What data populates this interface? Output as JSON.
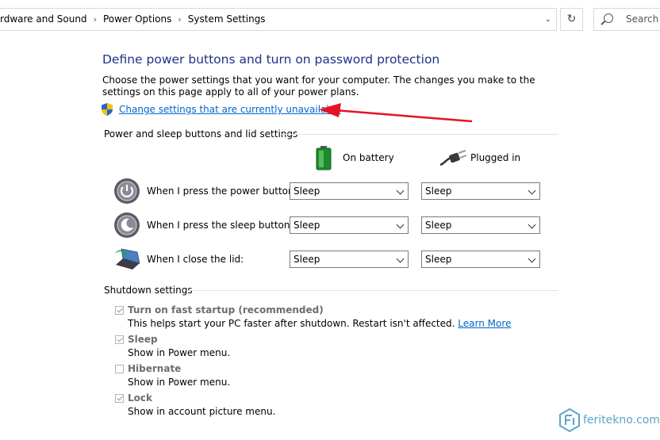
{
  "address": {
    "crumbs": [
      "rdware and Sound",
      "Power Options",
      "System Settings"
    ],
    "search_placeholder": "Search C"
  },
  "page": {
    "title": "Define power buttons and turn on password protection",
    "description": "Choose the power settings that you want for your computer. The changes you make to the settings on this page apply to all of your power plans.",
    "change_link": "Change settings that are currently unavailable"
  },
  "power_group": {
    "heading": "Power and sleep buttons and lid settings",
    "col_battery": "On battery",
    "col_plugged": "Plugged in",
    "rows": [
      {
        "label": "When I press the power button:",
        "battery": "Sleep",
        "plugged": "Sleep"
      },
      {
        "label": "When I press the sleep button:",
        "battery": "Sleep",
        "plugged": "Sleep"
      },
      {
        "label": "When I close the lid:",
        "battery": "Sleep",
        "plugged": "Sleep"
      }
    ]
  },
  "shutdown": {
    "heading": "Shutdown settings",
    "items": [
      {
        "label": "Turn on fast startup (recommended)",
        "desc": "This helps start your PC faster after shutdown. Restart isn't affected.",
        "link": "Learn More",
        "checked": true
      },
      {
        "label": "Sleep",
        "desc": "Show in Power menu.",
        "checked": true
      },
      {
        "label": "Hibernate",
        "desc": "Show in Power menu.",
        "checked": false
      },
      {
        "label": "Lock",
        "desc": "Show in account picture menu.",
        "checked": true
      }
    ]
  },
  "watermark": {
    "text": "feritekno.com"
  },
  "colors": {
    "title": "#1e3287",
    "link": "#0066cc",
    "arrow": "#e81123",
    "watermark": "#5fa3c9"
  }
}
